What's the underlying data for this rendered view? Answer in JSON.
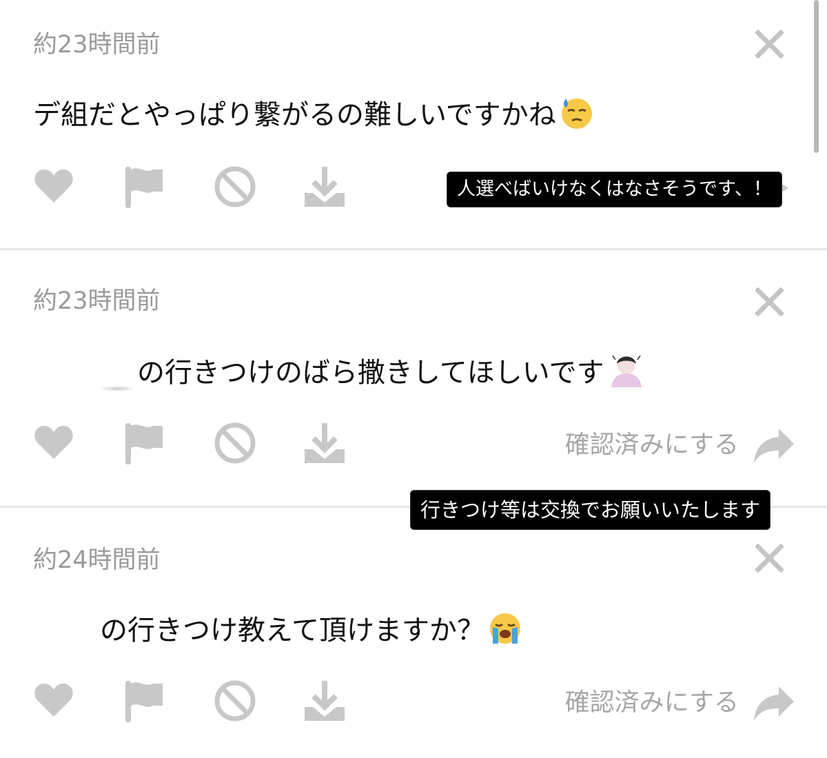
{
  "comments": [
    {
      "time": "約23時間前",
      "text": "デ組だとやっぱり繋がるの難しいですかね",
      "emoji": "sweat-face",
      "confirm_label": ""
    },
    {
      "time": "約23時間前",
      "text": "の行きつけのばら撒きしてほしいです",
      "emoji": "person-bowing",
      "confirm_label": "確認済みにする"
    },
    {
      "time": "約24時間前",
      "text": "の行きつけ教えて頂けますか？",
      "emoji": "loudly-crying-face",
      "confirm_label": "確認済みにする"
    }
  ],
  "overlays": {
    "reply1": "人選べばいけなくはなさそうです、！",
    "reply2": "行きつけ等は交換でお願いいたします"
  },
  "colors": {
    "icon_gray": "#c8c8c8",
    "time_gray": "#9a9a9a",
    "divider": "#e4e4e7",
    "tooltip_bg": "#000000"
  }
}
